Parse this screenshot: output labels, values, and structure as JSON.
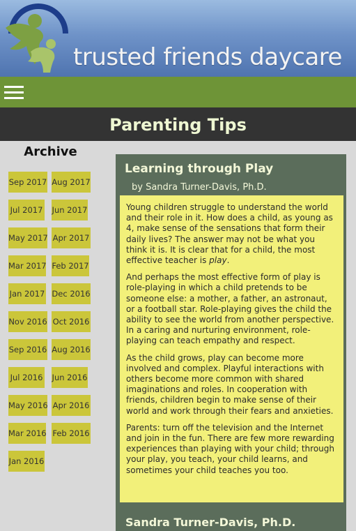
{
  "site": {
    "brand": "trusted friends daycare",
    "logo_icon": "trusted-friends-logo-icon",
    "menu_icon": "hamburger-menu-icon"
  },
  "page": {
    "title": "Parenting Tips"
  },
  "archive": {
    "title": "Archive",
    "items": [
      "Sep 2017",
      "Aug 2017",
      "Jul 2017",
      "Jun 2017",
      "May 2017",
      "Apr 2017",
      "Mar 2017",
      "Feb 2017",
      "Jan 2017",
      "Dec 2016",
      "Nov 2016",
      "Oct 2016",
      "Sep 2016",
      "Aug 2016",
      "Jul 2016",
      "Jun 2016",
      "May 2016",
      "Apr 2016",
      "Mar 2016",
      "Feb 2016",
      "Jan 2016"
    ]
  },
  "article": {
    "title": "Learning through Play",
    "byline": "by Sandra Turner-Davis, Ph.D.",
    "p1_a": "Young children struggle to understand the world and their role in it. How does a child, as young as 4, make sense of the sensations that form their daily lives? The answer may not be what you think it is. It is clear that for a child, the most effective teacher is ",
    "p1_em": "play",
    "p1_b": ".",
    "p2": "And perhaps the most effective form of play is role-playing in which a child pretends to be someone else: a mother, a father, an astronaut, or a football star. Role-playing gives the child the ability to see the world from another perspective. In a caring and nurturing environment, role-playing can teach empathy and respect.",
    "p3": "As the child grows, play can become more involved and complex. Playful interactions with others become more common with shared imaginations and roles. In cooperation with friends, children begin to make sense of their world and work through their fears and anxieties.",
    "p4": "Parents: turn off the television and the Internet and join in the fun. There are few more rewarding experiences than playing with your child; through your play, you teach, your child learns, and sometimes your child teaches you too.",
    "author_heading": "Sandra Turner-Davis, Ph.D."
  },
  "colors": {
    "header": "#6f93c8",
    "nav": "#6e9437",
    "titlebar": "#333333",
    "archive_item": "#cbc63a",
    "article_frame": "#5b6d5b",
    "article_body": "#f2f07a"
  }
}
